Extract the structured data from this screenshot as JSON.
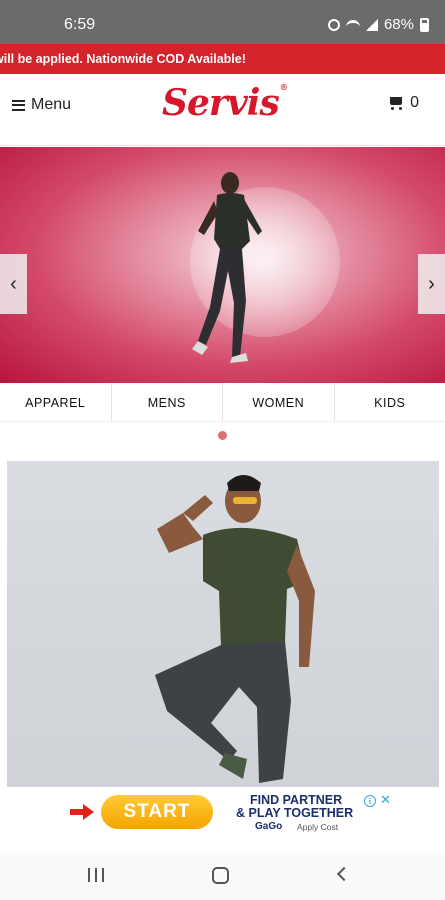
{
  "status_bar": {
    "time": "6:59",
    "battery": "68%",
    "icons": [
      "alarm-icon",
      "wifi-icon",
      "signal-icon",
      "battery-icon"
    ]
  },
  "promo_banner": {
    "text": "will be applied. Nationwide COD Available!",
    "color": "#d4232b"
  },
  "header": {
    "menu_label": "Menu",
    "logo_text": "Servis",
    "logo_mark": "®",
    "cart_count": "0",
    "brand_color": "#d7182a"
  },
  "hero_slider": {
    "prev_icon": "chevron-left-icon",
    "next_icon": "chevron-right-icon",
    "prev_glyph": "‹",
    "next_glyph": "›"
  },
  "category_tabs": [
    {
      "label": "APPAREL"
    },
    {
      "label": "MENS"
    },
    {
      "label": "WOMEN"
    },
    {
      "label": "KIDS"
    }
  ],
  "ad": {
    "button_label": "START",
    "line1": "FIND PARTNER",
    "line2": "& PLAY TOGETHER",
    "brand": "GaGo",
    "sub": "Apply Cost",
    "info_glyph": "i",
    "close_glyph": "✕"
  },
  "nav_bar": {
    "icons": [
      "recents-icon",
      "home-icon",
      "back-icon"
    ]
  }
}
